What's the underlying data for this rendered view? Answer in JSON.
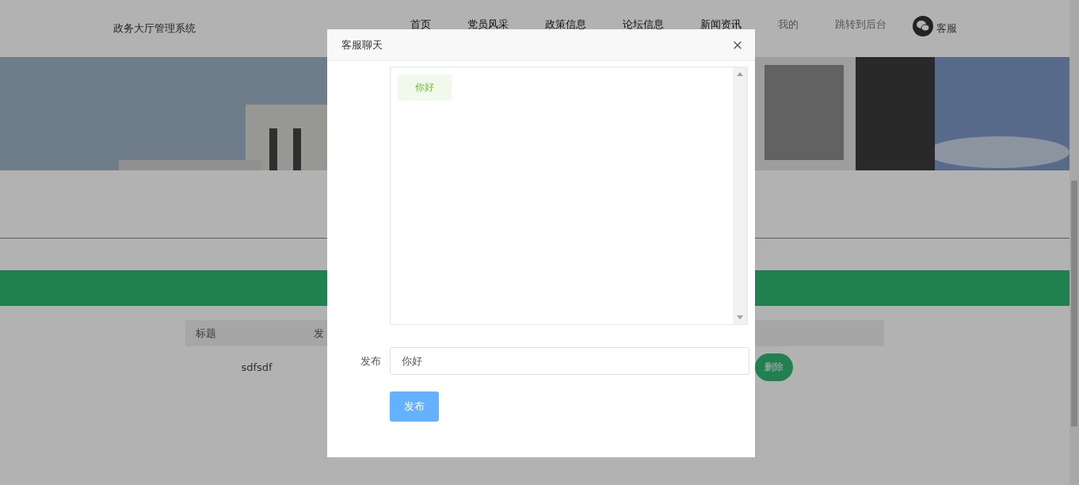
{
  "header": {
    "title": "政务大厅管理系统",
    "nav": [
      {
        "label": "首页",
        "kind": "primary"
      },
      {
        "label": "党员风采",
        "kind": "primary"
      },
      {
        "label": "政策信息",
        "kind": "primary"
      },
      {
        "label": "论坛信息",
        "kind": "primary"
      },
      {
        "label": "新闻资讯",
        "kind": "primary"
      },
      {
        "label": "我的",
        "kind": "secondary"
      },
      {
        "label": "跳转到后台",
        "kind": "secondary"
      }
    ],
    "service": "客服"
  },
  "table": {
    "columns": [
      "标题",
      "发"
    ],
    "rows": [
      {
        "cells": [
          "sdfsdf"
        ],
        "action": "删除"
      }
    ]
  },
  "dialog": {
    "title": "客服聊天",
    "messages": [
      {
        "text": "你好"
      }
    ],
    "form": {
      "label": "发布",
      "value": "你好",
      "submit": "发布"
    }
  }
}
